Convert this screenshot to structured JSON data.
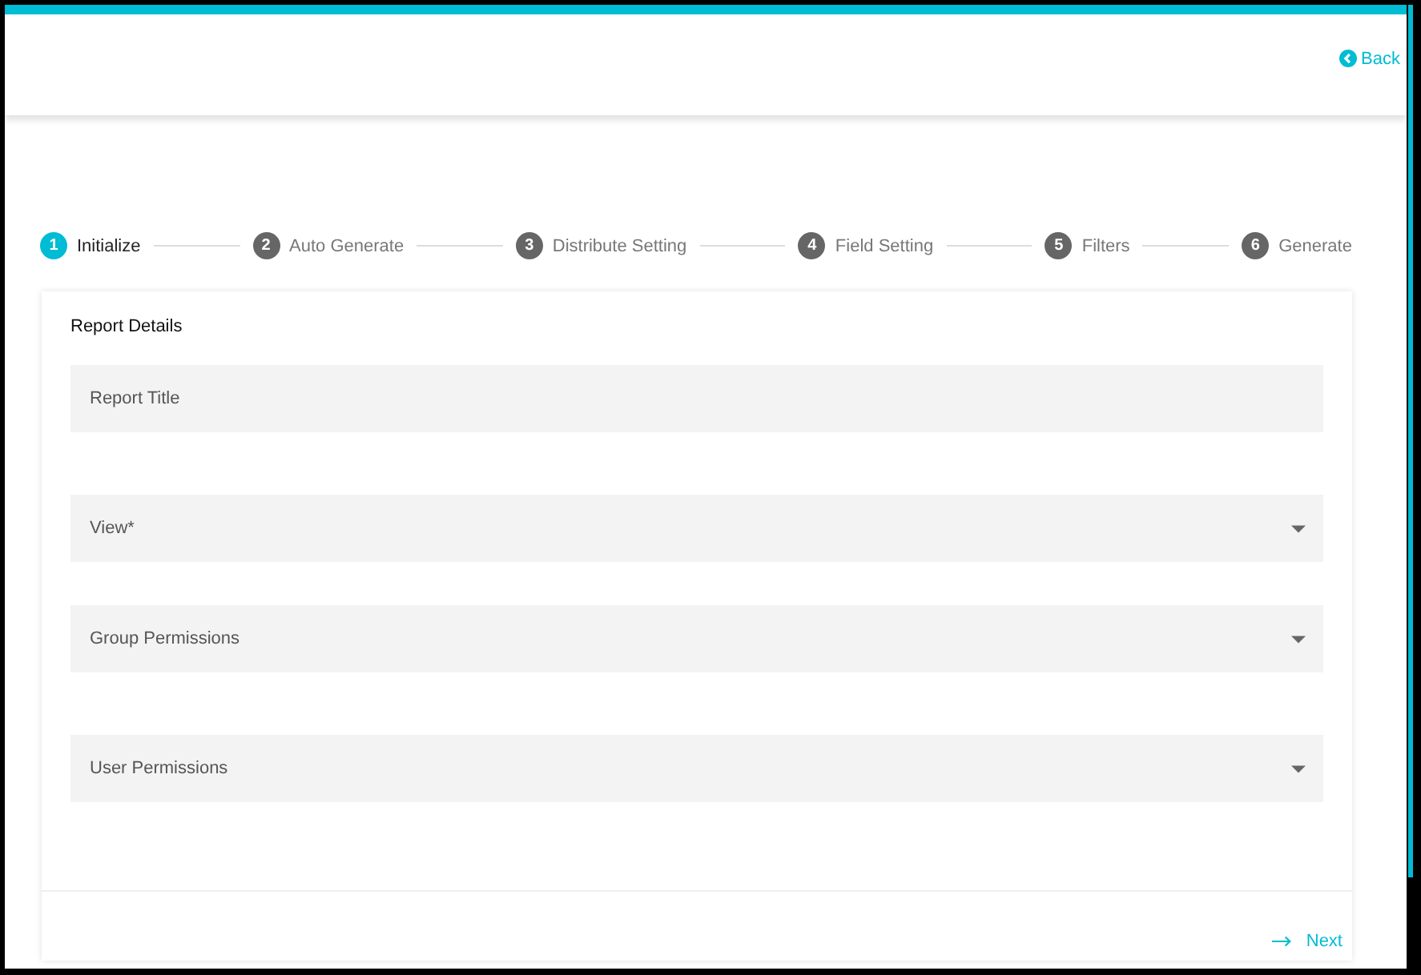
{
  "header": {
    "back_link": "Back"
  },
  "steps": [
    {
      "number": "1",
      "label": "Initialize",
      "selected": true
    },
    {
      "number": "2",
      "label": "Auto Generate",
      "selected": false
    },
    {
      "number": "3",
      "label": "Distribute Setting",
      "selected": false
    },
    {
      "number": "4",
      "label": "Field Setting",
      "selected": false
    },
    {
      "number": "5",
      "label": "Filters",
      "selected": false
    },
    {
      "number": "6",
      "label": "Generate",
      "selected": false
    }
  ],
  "card": {
    "title": "Report Details",
    "fields": [
      {
        "kind": "text",
        "placeholder": "Report Title"
      },
      {
        "kind": "select",
        "placeholder": "View*"
      },
      {
        "kind": "select",
        "placeholder": "Group Permissions"
      },
      {
        "kind": "select",
        "placeholder": "User Permissions"
      }
    ],
    "next_button": "Next"
  }
}
